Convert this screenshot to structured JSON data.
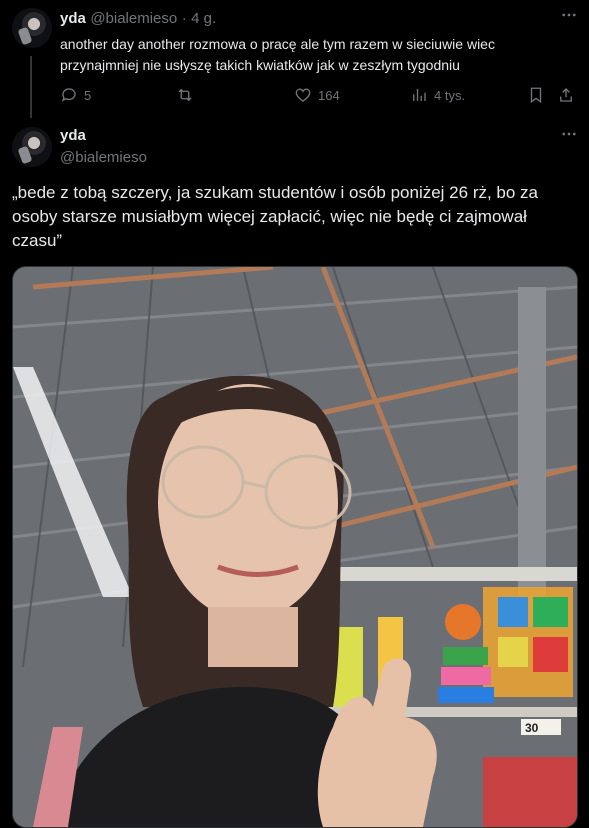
{
  "tweet1": {
    "name": "yda",
    "handle": "@bialemieso",
    "separator": "·",
    "time": "4 g.",
    "text": "another day another rozmowa o pracę ale tym razem w sieciuwie wiec przynajmniej nie usłyszę takich kwiatków jak w zeszłym tygodniu",
    "more_icon": "more-horizontal-icon",
    "actions": {
      "replies": "5",
      "retweets": "",
      "likes": "164",
      "views": "4 tys."
    }
  },
  "tweet2": {
    "name": "yda",
    "handle": "@bialemieso",
    "text": "„bede z tobą szczery, ja szukam studentów i osób poniżej 26 rż, bo za osoby starsze musiałbym więcej zapłacić, więc nie będę ci zajmował czasu”",
    "more_icon": "more-horizontal-icon",
    "photo_price_tag": "30"
  },
  "colors": {
    "background": "#000000",
    "text": "#e7e9ea",
    "muted": "#71767b",
    "divider": "#2f3336"
  }
}
